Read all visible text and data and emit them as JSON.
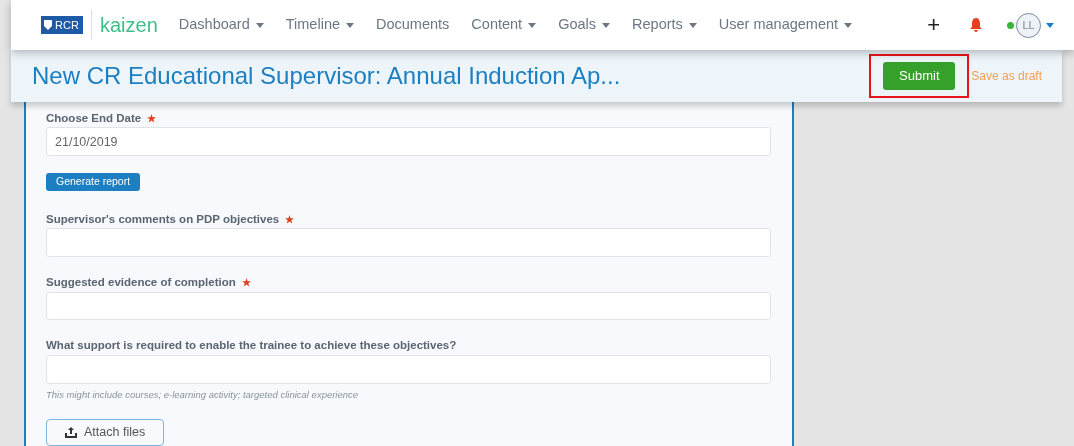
{
  "navbar": {
    "logo_text": "RCR",
    "brand": "kaizen",
    "items": [
      {
        "label": "Dashboard",
        "dropdown": true
      },
      {
        "label": "Timeline",
        "dropdown": true
      },
      {
        "label": "Documents",
        "dropdown": false
      },
      {
        "label": "Content",
        "dropdown": true
      },
      {
        "label": "Goals",
        "dropdown": true
      },
      {
        "label": "Reports",
        "dropdown": true
      },
      {
        "label": "User management",
        "dropdown": true
      }
    ],
    "add": "+",
    "user": {
      "initials": "LL",
      "online": true
    }
  },
  "header": {
    "title": "New CR Educational Supervisor: Annual Induction Ap...",
    "submit": {
      "label": "Submit",
      "highlighted": true
    },
    "save_draft": "Save as draft"
  },
  "form": {
    "items": [
      {
        "kind": "field",
        "label": "Choose End Date",
        "required": true,
        "value": "21/10/2019"
      },
      {
        "kind": "button",
        "label": "Generate report"
      },
      {
        "kind": "field",
        "label": "Supervisor's comments on PDP objectives",
        "required": true
      },
      {
        "kind": "field",
        "label": "Suggested evidence of completion",
        "required": true
      },
      {
        "kind": "field",
        "label": "What support is required to enable the trainee to achieve these objectives?",
        "required": false,
        "hint": "This might include courses; e-learning activity; targeted clinical experience"
      },
      {
        "kind": "attach",
        "label": "Attach files"
      }
    ]
  }
}
